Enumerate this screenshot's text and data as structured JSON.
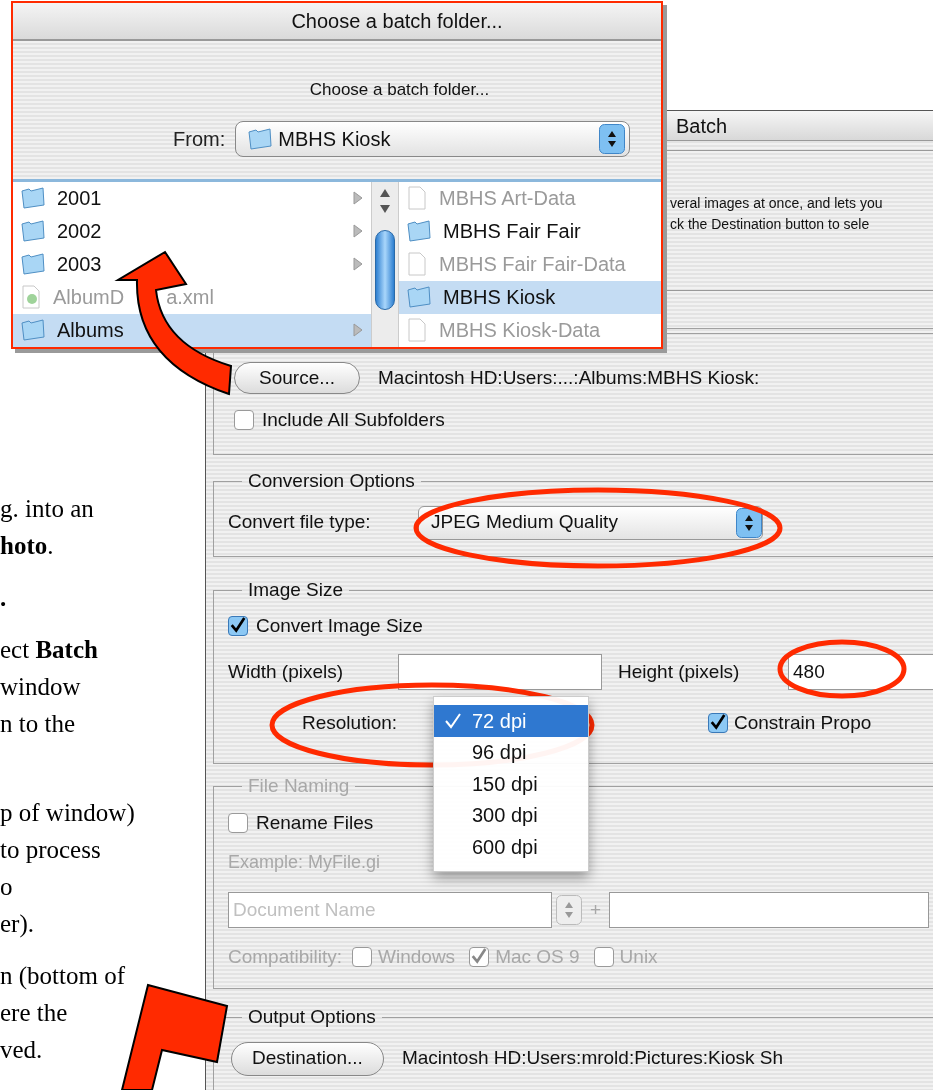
{
  "instructions": [
    {
      "bold": false,
      "lines": [
        "g. into an",
        "**hoto**."
      ]
    },
    {
      "bold": true,
      "lines": [
        "."
      ]
    },
    {
      "bold": false,
      "lines": [
        "ect **Batch**",
        "window",
        "n to the"
      ]
    },
    {
      "bold": false,
      "lines": [
        "p of window)",
        "to process",
        "o",
        "er)."
      ]
    },
    {
      "bold": false,
      "lines": [
        "n (bottom of",
        "ere the",
        "ved."
      ]
    }
  ],
  "batch_window": {
    "title": "Batch",
    "intro_lines": [
      "veral images at  once, and lets you",
      "ck the  Destination button to sele"
    ],
    "source": {
      "button": "Source...",
      "path": "Macintosh HD:Users:...:Albums:MBHS Kiosk:",
      "include_subfolders": {
        "label": "Include All Subfolders",
        "checked": false
      }
    },
    "conversion": {
      "legend": "Conversion Options",
      "label": "Convert file type:",
      "value": "JPEG Medium Quality"
    },
    "image_size": {
      "legend": "Image Size",
      "convert": {
        "label": "Convert Image Size",
        "checked": true
      },
      "width_label": "Width (pixels)",
      "height_label": "Height (pixels)",
      "height_value": "480",
      "resolution_label": "Resolution:",
      "constrain": {
        "label": "Constrain Propo",
        "checked": true
      }
    },
    "resolution_menu": [
      {
        "label": "72 dpi",
        "selected": true
      },
      {
        "label": "96 dpi",
        "selected": false
      },
      {
        "label": "150 dpi",
        "selected": false
      },
      {
        "label": "300 dpi",
        "selected": false
      },
      {
        "label": "600 dpi",
        "selected": false
      }
    ],
    "file_naming": {
      "legend": "File Naming",
      "disabled": true,
      "rename": {
        "label": "Rename Files",
        "checked": false
      },
      "example": "Example: MyFile.gi",
      "name_placeholder": "Document Name",
      "plus": "+",
      "compatibility_label": "Compatibility:",
      "platforms": [
        {
          "label": "Windows",
          "checked": false
        },
        {
          "label": "Mac OS 9",
          "checked": true
        },
        {
          "label": "Unix",
          "checked": false
        }
      ]
    },
    "output": {
      "legend": "Output Options",
      "button": "Destination...",
      "path": "Macintosh HD:Users:mrold:Pictures:Kiosk Sh"
    }
  },
  "folder_dialog": {
    "title": "Choose a batch folder...",
    "prompt": "Choose a batch folder...",
    "from_label": "From:",
    "from_value": "MBHS Kiosk",
    "left_column": [
      {
        "name": "2001",
        "kind": "folder",
        "selected": false
      },
      {
        "name": "2002",
        "kind": "folder",
        "selected": false
      },
      {
        "name": "2003",
        "kind": "folder",
        "selected": false
      },
      {
        "name": "AlbumD",
        "name_tail": "a.xml",
        "kind": "xml",
        "selected": false
      },
      {
        "name": "Albums",
        "kind": "folder",
        "selected": true
      }
    ],
    "right_column": [
      {
        "name": "MBHS Art-Data",
        "kind": "file",
        "selected": false
      },
      {
        "name": "MBHS Fair Fair",
        "kind": "folder",
        "selected": false
      },
      {
        "name": "MBHS Fair Fair-Data",
        "kind": "file",
        "selected": false
      },
      {
        "name": "MBHS Kiosk",
        "kind": "folder",
        "selected": true
      },
      {
        "name": "MBHS Kiosk-Data",
        "kind": "file",
        "selected": false
      }
    ]
  }
}
